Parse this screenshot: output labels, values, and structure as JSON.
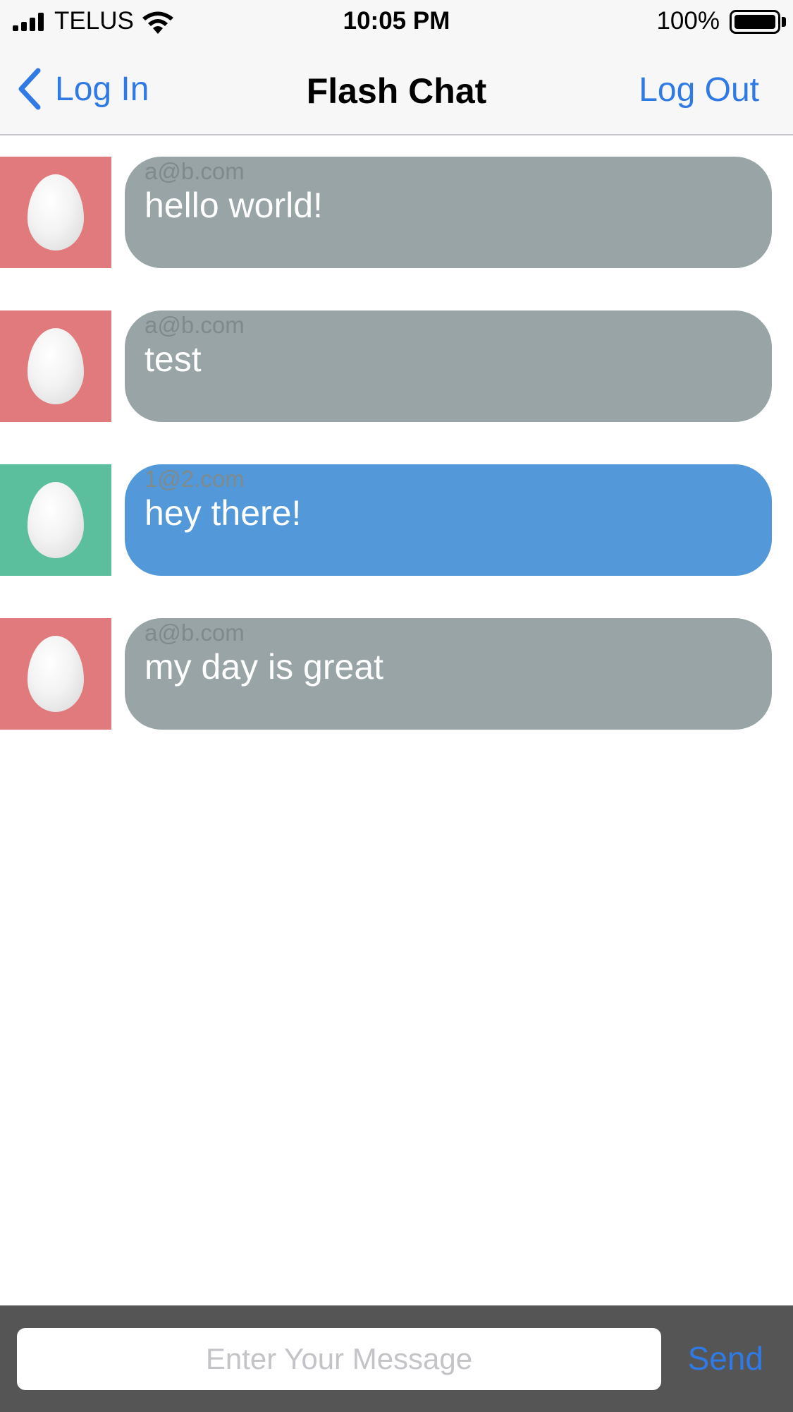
{
  "status_bar": {
    "carrier": "TELUS",
    "time": "10:05 PM",
    "battery_percent": "100%"
  },
  "nav": {
    "back_label": "Log In",
    "title": "Flash Chat",
    "right_label": "Log Out"
  },
  "messages": [
    {
      "sender": "a@b.com",
      "body": "hello world!",
      "avatar_color": "#e07a7c",
      "bubble_color": "#98a4a5"
    },
    {
      "sender": "a@b.com",
      "body": "test",
      "avatar_color": "#e07a7c",
      "bubble_color": "#98a4a5"
    },
    {
      "sender": "1@2.com",
      "body": "hey there!",
      "avatar_color": "#5bbf9e",
      "bubble_color": "#5398d9"
    },
    {
      "sender": "a@b.com",
      "body": "my day is great",
      "avatar_color": "#e07a7c",
      "bubble_color": "#98a4a5"
    }
  ],
  "composer": {
    "placeholder": "Enter Your Message",
    "value": "",
    "send_label": "Send"
  },
  "icons": {
    "signal": "cellular-signal-icon",
    "wifi": "wifi-icon",
    "battery": "battery-icon",
    "back": "chevron-left-icon",
    "avatar": "egg-avatar-icon"
  },
  "colors": {
    "accent": "#2f7ae5",
    "composer_background": "#555555"
  }
}
